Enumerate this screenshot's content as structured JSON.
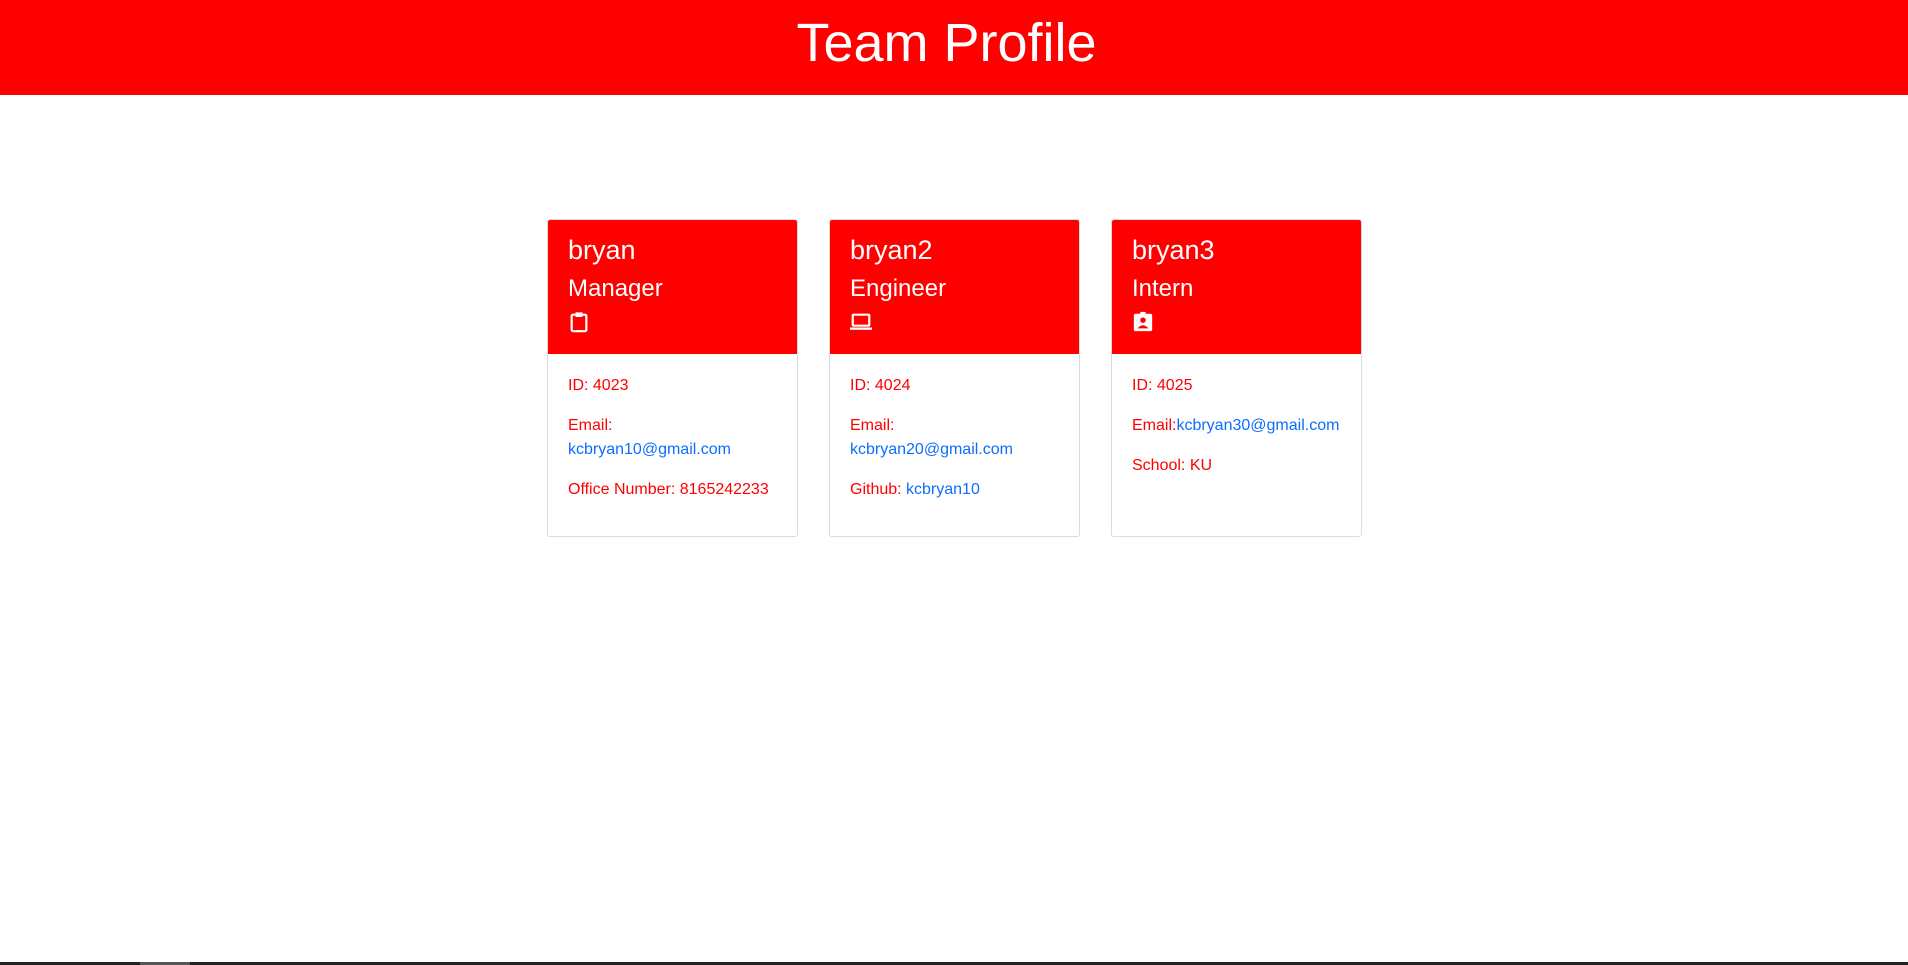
{
  "header": {
    "title": "Team Profile"
  },
  "colors": {
    "brand": "#ff0000",
    "link": "#0d6efd",
    "header_text": "#ffffff"
  },
  "cards": [
    {
      "name": "bryan",
      "role": "Manager",
      "icon": "clipboard-icon",
      "id_label": "ID: 4023",
      "email_label": "Email:",
      "email": "kcbryan10@gmail.com",
      "extra_label": "Office Number: 8165242233",
      "extra_value": ""
    },
    {
      "name": "bryan2",
      "role": "Engineer",
      "icon": "laptop-icon",
      "id_label": "ID: 4024",
      "email_label": "Email:",
      "email": "kcbryan20@gmail.com",
      "extra_label": "Github: ",
      "extra_value": "kcbryan10"
    },
    {
      "name": "bryan3",
      "role": "Intern",
      "icon": "badge-icon",
      "id_label": "ID: 4025",
      "email_label": "Email:",
      "email": "kcbryan30@gmail.com",
      "extra_label": "School: KU",
      "extra_value": ""
    }
  ]
}
